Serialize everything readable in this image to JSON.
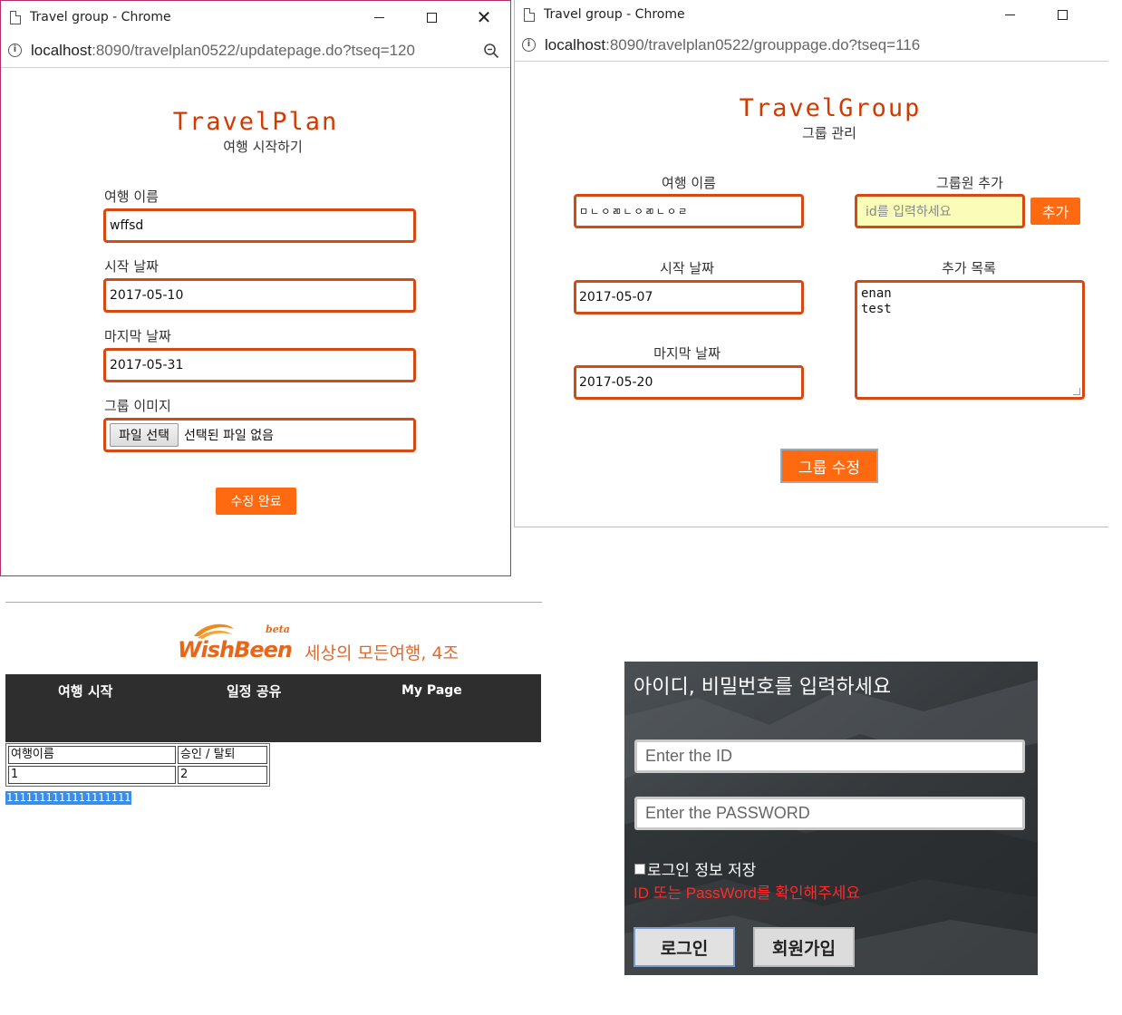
{
  "plan_window": {
    "title": "Travel group - Chrome",
    "url_host": "localhost",
    "url_rest": ":8090/travelplan0522/updatepage.do?tseq=120",
    "heading": "TravelPlan",
    "subheading": "여행 시작하기",
    "fields": {
      "name_label": "여행 이름",
      "name_value": "wffsd",
      "start_label": "시작 날짜",
      "start_value": "2017-05-10",
      "end_label": "마지막 날짜",
      "end_value": "2017-05-31",
      "image_label": "그룹 이미지",
      "file_button": "파일 선택",
      "file_status": "선택된 파일 없음"
    },
    "submit": "수정 완료"
  },
  "group_window": {
    "title": "Travel group - Chrome",
    "url_host": "localhost",
    "url_rest": ":8090/travelplan0522/grouppage.do?tseq=116",
    "heading": "TravelGroup",
    "subheading": "그룹 관리",
    "name_label": "여행 이름",
    "name_value": "ㅁㄴㅇㄻㄴㅇㄻㄴㅇㄹ",
    "start_label": "시작 날짜",
    "start_value": "2017-05-07",
    "end_label": "마지막 날짜",
    "end_value": "2017-05-20",
    "member_label": "그룹원 추가",
    "member_placeholder": "id를 입력하세요",
    "add_button": "추가",
    "list_label": "추가 목록",
    "list_value": "enan\ntest",
    "edit_button": "그룹 수정"
  },
  "wishbeen": {
    "logo_text": "WishBeen",
    "logo_beta": "beta",
    "tagline": "세상의 모든여행, 4조",
    "nav": [
      "여행 시작",
      "일정 공유",
      "My Page"
    ],
    "table_headers": [
      "여행이름",
      "승인 / 탈퇴"
    ],
    "table_rows": [
      [
        "1",
        "2"
      ]
    ],
    "selected_text": "1111111111111111111"
  },
  "login": {
    "title": "아이디, 비밀번호를 입력하세요",
    "id_placeholder": "Enter the ID",
    "pw_placeholder": "Enter the PASSWORD",
    "remember_label": "로그인 정보 저장",
    "error": "ID 또는 PassWord를 확인해주세요",
    "login_button": "로그인",
    "signup_button": "회원가입"
  },
  "colors": {
    "accent_orange": "#ff6a10",
    "title_red": "#d23a00",
    "input_border": "#d44a14",
    "error_red": "#ff2b2b",
    "nav_dark": "#2e2e2e"
  }
}
